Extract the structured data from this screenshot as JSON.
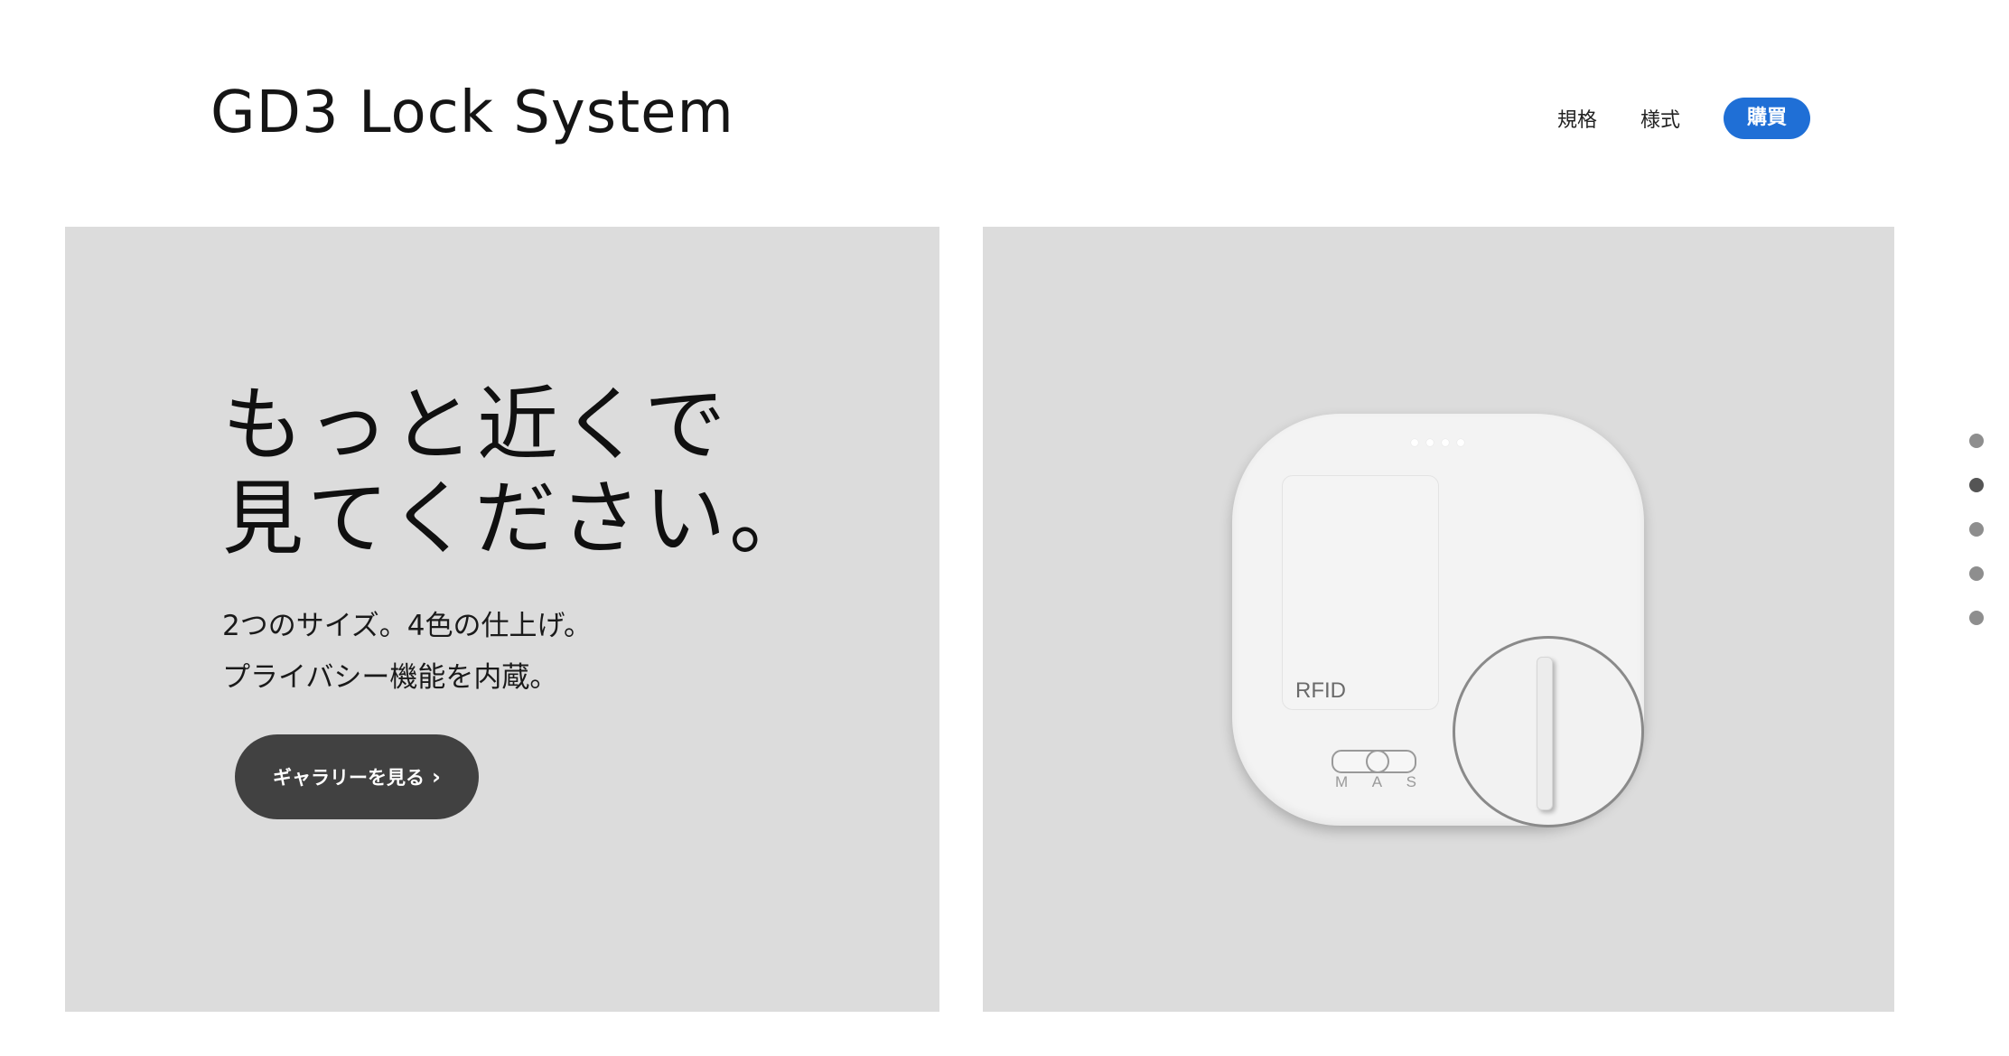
{
  "header": {
    "logo": "GD3 Lock System",
    "nav": [
      {
        "label": "規格"
      },
      {
        "label": "様式"
      }
    ],
    "buy_label": "購買"
  },
  "hero": {
    "headline_line1": "もっと近くで",
    "headline_line2": "見てください。",
    "sub_line1": "2つのサイズ。4色の仕上げ。",
    "sub_line2": "プライバシー機能を内蔵。",
    "cta_label": "ギャラリーを見る",
    "cta_icon": "chevron-right-icon"
  },
  "device": {
    "rfid_label": "RFID",
    "switch_labels": [
      "M",
      "A",
      "S"
    ]
  },
  "pager": {
    "count": 5,
    "active_index": 1
  },
  "colors": {
    "accent": "#1f6fd6",
    "panel": "#dcdcdc",
    "button_dark": "#414141"
  }
}
